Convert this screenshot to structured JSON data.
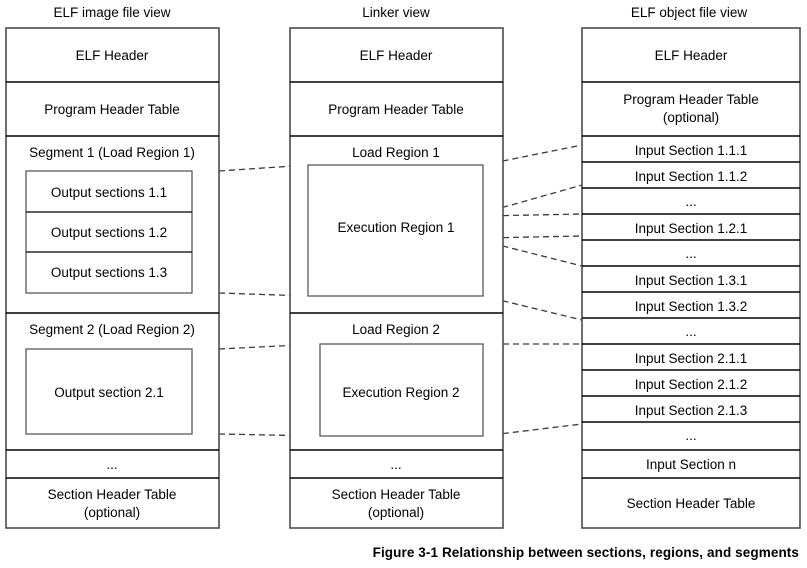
{
  "figure": {
    "caption": "Figure 3-1  Relationship between sections, regions, and segments"
  },
  "columns": [
    {
      "id": "elf-image-file-view",
      "title": "ELF image file view",
      "rows": [
        {
          "label": "ELF Header"
        },
        {
          "label": "Program Header Table"
        },
        {
          "label": "Segment 1 (Load Region 1)",
          "children": [
            {
              "label": "Output sections 1.1"
            },
            {
              "label": "Output sections 1.2"
            },
            {
              "label": "Output sections 1.3"
            }
          ]
        },
        {
          "label": "Segment 2 (Load Region 2)",
          "children": [
            {
              "label": "Output section 2.1"
            }
          ]
        },
        {
          "label": "..."
        },
        {
          "label": "Section Header Table",
          "label2": "(optional)"
        }
      ]
    },
    {
      "id": "linker-view",
      "title": "Linker view",
      "rows": [
        {
          "label": "ELF Header"
        },
        {
          "label": "Program Header Table"
        },
        {
          "label": "Load Region 1",
          "children": [
            {
              "label": "Execution Region 1"
            }
          ]
        },
        {
          "label": "Load Region 2",
          "children": [
            {
              "label": "Execution Region 2"
            }
          ]
        },
        {
          "label": "..."
        },
        {
          "label": "Section Header Table",
          "label2": "(optional)"
        }
      ]
    },
    {
      "id": "elf-object-file-view",
      "title": "ELF object file view",
      "rows": [
        {
          "label": "ELF Header"
        },
        {
          "label": "Program Header Table",
          "label2": "(optional)"
        },
        {
          "label": "Input Section 1.1.1"
        },
        {
          "label": "Input Section 1.1.2"
        },
        {
          "label": "..."
        },
        {
          "label": "Input Section 1.2.1"
        },
        {
          "label": "..."
        },
        {
          "label": "Input Section 1.3.1"
        },
        {
          "label": "Input Section 1.3.2"
        },
        {
          "label": "..."
        },
        {
          "label": "Input Section 2.1.1"
        },
        {
          "label": "Input Section 2.1.2"
        },
        {
          "label": "Input Section 2.1.3"
        },
        {
          "label": "..."
        },
        {
          "label": "Input Section n"
        },
        {
          "label": "Section Header Table"
        }
      ]
    }
  ],
  "colors": {
    "background": "#ffffff",
    "line": "#000000",
    "outline": "#4d4d4d",
    "connector": "#3a3a3a",
    "text": "#000000"
  }
}
